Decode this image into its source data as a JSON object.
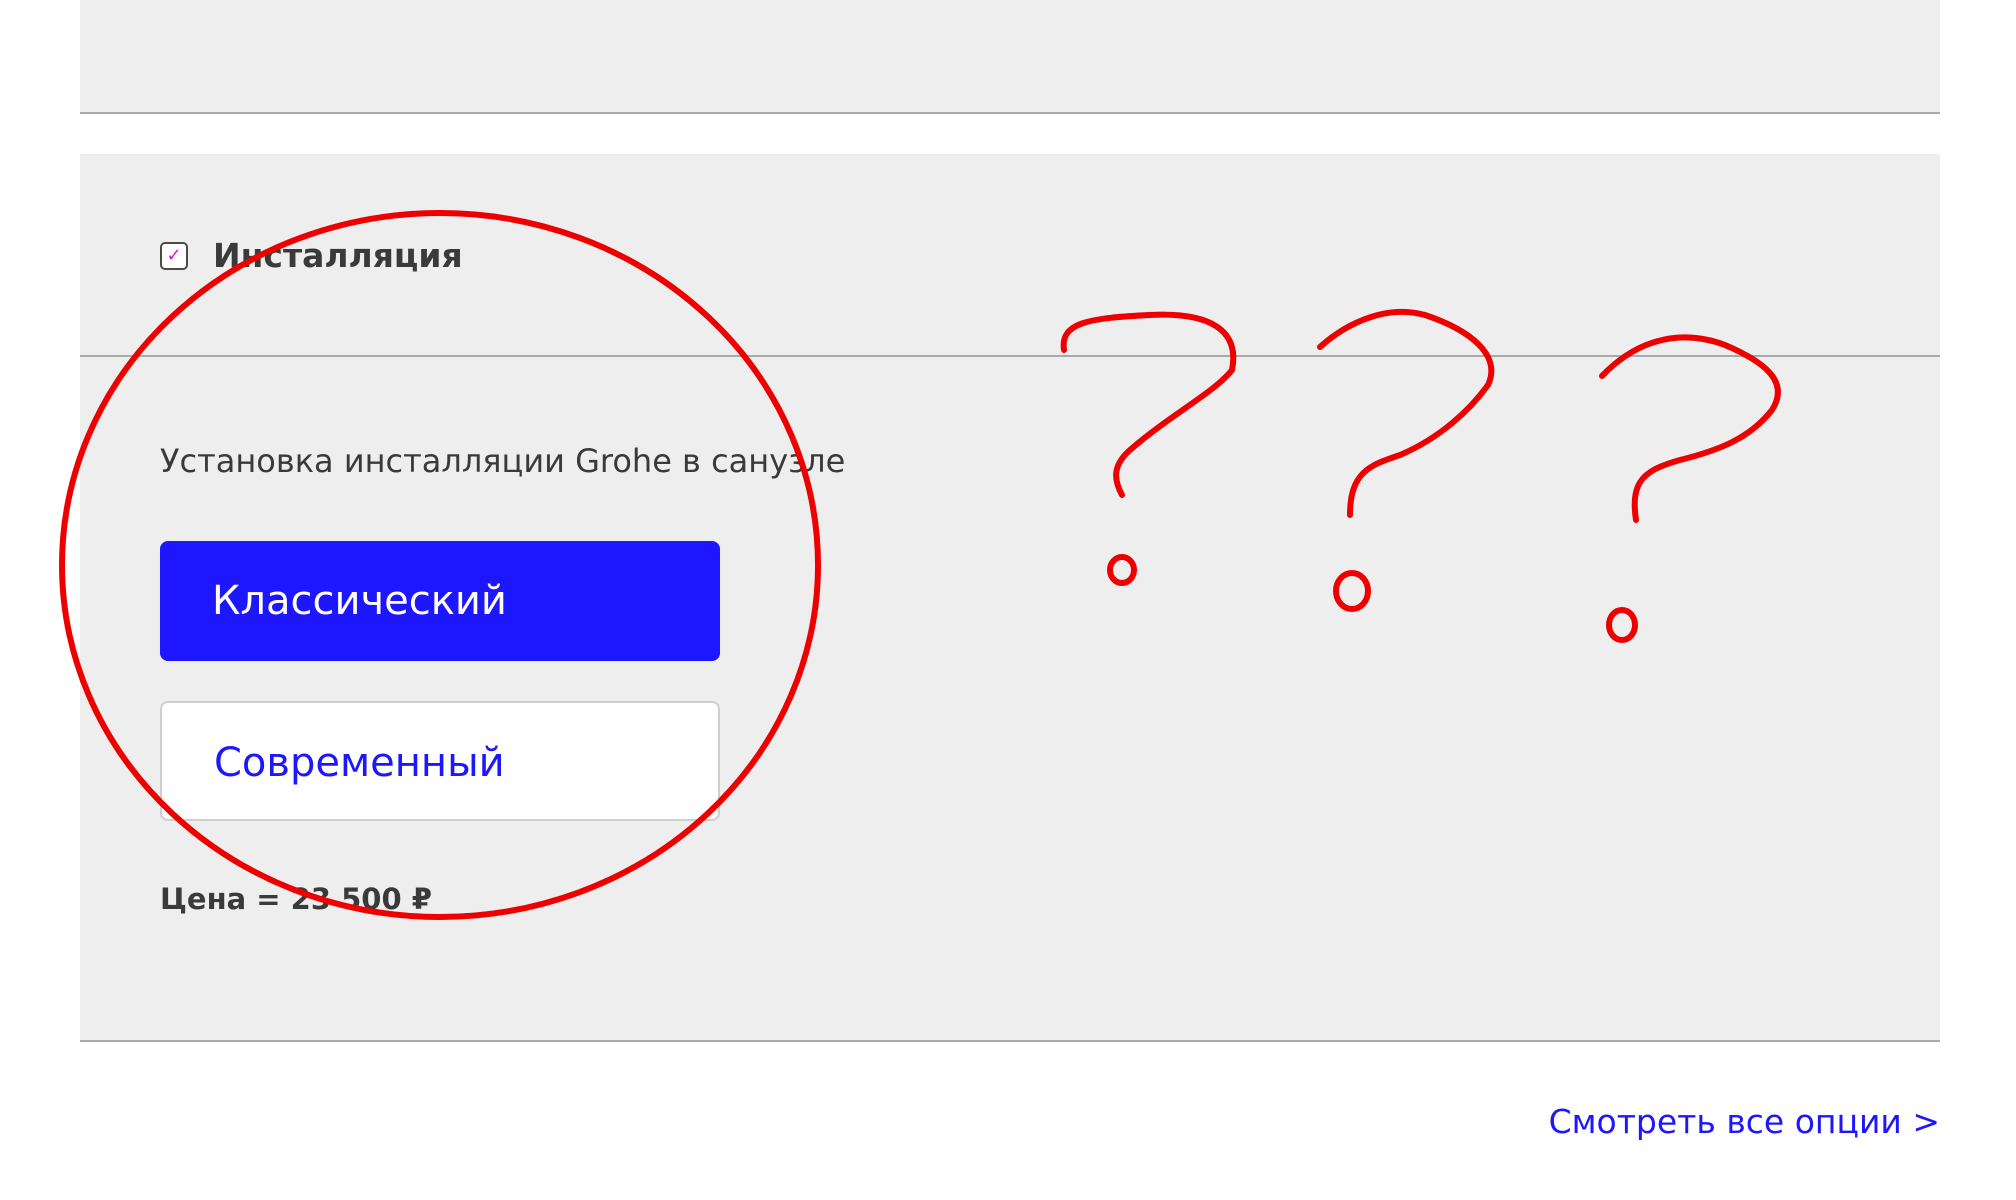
{
  "option": {
    "checkbox_mark": "✓",
    "title": "Инсталляция",
    "description": "Установка инсталляции Grohe в санузле",
    "variants": [
      {
        "label": "Классический",
        "selected": true
      },
      {
        "label": "Современный",
        "selected": false
      }
    ],
    "price": "Цена = 23 500 ₽"
  },
  "footer": {
    "see_all_link": "Смотреть все опции >"
  },
  "colors": {
    "accent": "#1d16ff",
    "panel": "#eeeeee",
    "annotation": "#ee0000"
  }
}
